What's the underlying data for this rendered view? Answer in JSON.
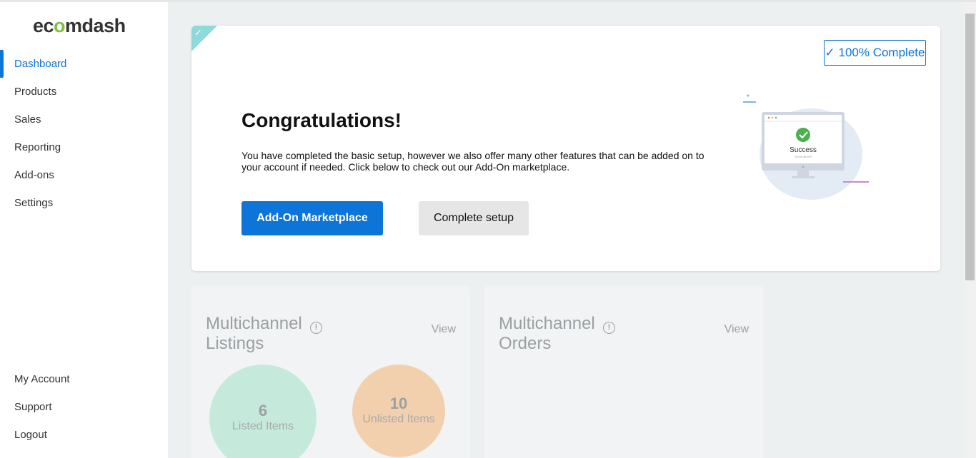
{
  "app": {
    "logo_parts": [
      "ec",
      "o",
      "mdash"
    ]
  },
  "sidebar": {
    "items": [
      {
        "label": "Dashboard"
      },
      {
        "label": "Products"
      },
      {
        "label": "Sales"
      },
      {
        "label": "Reporting"
      },
      {
        "label": "Add-ons"
      },
      {
        "label": "Settings"
      }
    ],
    "bottom_items": [
      {
        "label": "My Account"
      },
      {
        "label": "Support"
      },
      {
        "label": "Logout"
      }
    ]
  },
  "setup_card": {
    "badge": "✓ 100% Complete",
    "title": "Congratulations!",
    "text": "You have completed the basic setup, however we also offer many other features that can be added on to your account if needed. Click below to check out our Add-On marketplace.",
    "primary_button": "Add-On Marketplace",
    "secondary_button": "Complete setup",
    "illustration_title": "Success",
    "illustration_subtitle": "You're all set!"
  },
  "listings_panel": {
    "title": "Multichannel Listings",
    "view": "View",
    "listed_count": "6",
    "listed_label": "Listed Items",
    "unlisted_count": "10",
    "unlisted_label": "Unlisted Items"
  },
  "orders_panel": {
    "title": "Multichannel Orders",
    "view": "View"
  },
  "colors": {
    "accent": "#0d75d8",
    "logo_green": "#7ac143",
    "listed_bubble": "#c5eadc",
    "unlisted_bubble": "#f3d0ad"
  }
}
